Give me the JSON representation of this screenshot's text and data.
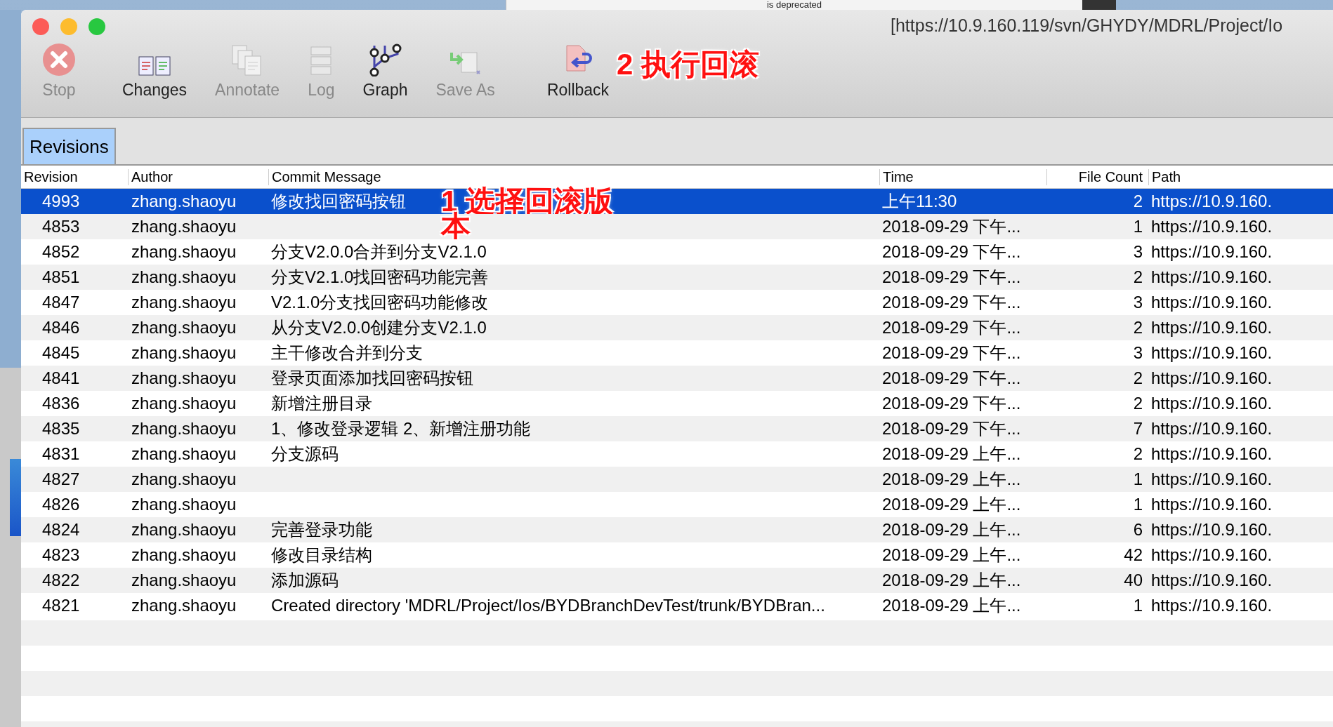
{
  "background_window": {
    "text": "is deprecated"
  },
  "window": {
    "title": "[https://10.9.160.119/svn/GHYDY/MDRL/Project/Io"
  },
  "toolbar": [
    {
      "kind": "stop",
      "label": "Stop",
      "disabled": true
    },
    {
      "kind": "changes",
      "label": "Changes",
      "disabled": false
    },
    {
      "kind": "annotate",
      "label": "Annotate",
      "disabled": true
    },
    {
      "kind": "log",
      "label": "Log",
      "disabled": true
    },
    {
      "kind": "graph",
      "label": "Graph",
      "disabled": false
    },
    {
      "kind": "saveas",
      "label": "Save As",
      "disabled": true
    },
    {
      "kind": "rollback",
      "label": "Rollback",
      "disabled": false
    }
  ],
  "tabs": [
    {
      "label": "Revisions",
      "selected": true
    }
  ],
  "table": {
    "columns": [
      "Revision",
      "Author",
      "Commit Message",
      "Time",
      "File Count",
      "Path"
    ],
    "rows": [
      {
        "revision": "4993",
        "author": "zhang.shaoyu",
        "message": "修改找回密码按钮",
        "time": "上午11:30",
        "file_count": "2",
        "path": "https://10.9.160.",
        "selected": true
      },
      {
        "revision": "4853",
        "author": "zhang.shaoyu",
        "time": "2018-09-29 下午...",
        "file_count": "1",
        "path": "https://10.9.160.",
        "selected": false
      },
      {
        "revision": "4852",
        "author": "zhang.shaoyu",
        "message": "分支V2.0.0合并到分支V2.1.0",
        "time": "2018-09-29 下午...",
        "file_count": "3",
        "path": "https://10.9.160.",
        "selected": false
      },
      {
        "revision": "4851",
        "author": "zhang.shaoyu",
        "message": "分支V2.1.0找回密码功能完善",
        "time": "2018-09-29 下午...",
        "file_count": "2",
        "path": "https://10.9.160.",
        "selected": false
      },
      {
        "revision": "4847",
        "author": "zhang.shaoyu",
        "message": "V2.1.0分支找回密码功能修改",
        "time": "2018-09-29 下午...",
        "file_count": "3",
        "path": "https://10.9.160.",
        "selected": false
      },
      {
        "revision": "4846",
        "author": "zhang.shaoyu",
        "message": "从分支V2.0.0创建分支V2.1.0",
        "time": "2018-09-29 下午...",
        "file_count": "2",
        "path": "https://10.9.160.",
        "selected": false
      },
      {
        "revision": "4845",
        "author": "zhang.shaoyu",
        "message": "主干修改合并到分支",
        "time": "2018-09-29 下午...",
        "file_count": "3",
        "path": "https://10.9.160.",
        "selected": false
      },
      {
        "revision": "4841",
        "author": "zhang.shaoyu",
        "message": "登录页面添加找回密码按钮",
        "time": "2018-09-29 下午...",
        "file_count": "2",
        "path": "https://10.9.160.",
        "selected": false
      },
      {
        "revision": "4836",
        "author": "zhang.shaoyu",
        "message": "新增注册目录",
        "time": "2018-09-29 下午...",
        "file_count": "2",
        "path": "https://10.9.160.",
        "selected": false
      },
      {
        "revision": "4835",
        "author": "zhang.shaoyu",
        "message": "1、修改登录逻辑 2、新增注册功能",
        "time": "2018-09-29 下午...",
        "file_count": "7",
        "path": "https://10.9.160.",
        "selected": false
      },
      {
        "revision": "4831",
        "author": "zhang.shaoyu",
        "message": "分支源码",
        "time": "2018-09-29 上午...",
        "file_count": "2",
        "path": "https://10.9.160.",
        "selected": false
      },
      {
        "revision": "4827",
        "author": "zhang.shaoyu",
        "time": "2018-09-29 上午...",
        "file_count": "1",
        "path": "https://10.9.160.",
        "selected": false
      },
      {
        "revision": "4826",
        "author": "zhang.shaoyu",
        "time": "2018-09-29 上午...",
        "file_count": "1",
        "path": "https://10.9.160.",
        "selected": false
      },
      {
        "revision": "4824",
        "author": "zhang.shaoyu",
        "message": "完善登录功能",
        "time": "2018-09-29 上午...",
        "file_count": "6",
        "path": "https://10.9.160.",
        "selected": false
      },
      {
        "revision": "4823",
        "author": "zhang.shaoyu",
        "message": "修改目录结构",
        "time": "2018-09-29 上午...",
        "file_count": "42",
        "path": "https://10.9.160.",
        "selected": false
      },
      {
        "revision": "4822",
        "author": "zhang.shaoyu",
        "message": "添加源码",
        "time": "2018-09-29 上午...",
        "file_count": "40",
        "path": "https://10.9.160.",
        "selected": false
      },
      {
        "revision": "4821",
        "author": "zhang.shaoyu",
        "message": "Created directory 'MDRL/Project/Ios/BYDBranchDevTest/trunk/BYDBran...",
        "time": "2018-09-29 上午...",
        "file_count": "1",
        "path": "https://10.9.160.",
        "selected": false
      }
    ]
  },
  "annotations": [
    {
      "text": "2 执行回滚"
    }
  ],
  "row_callout": {
    "lines": [
      "1 选择回滚版",
      "本"
    ]
  }
}
